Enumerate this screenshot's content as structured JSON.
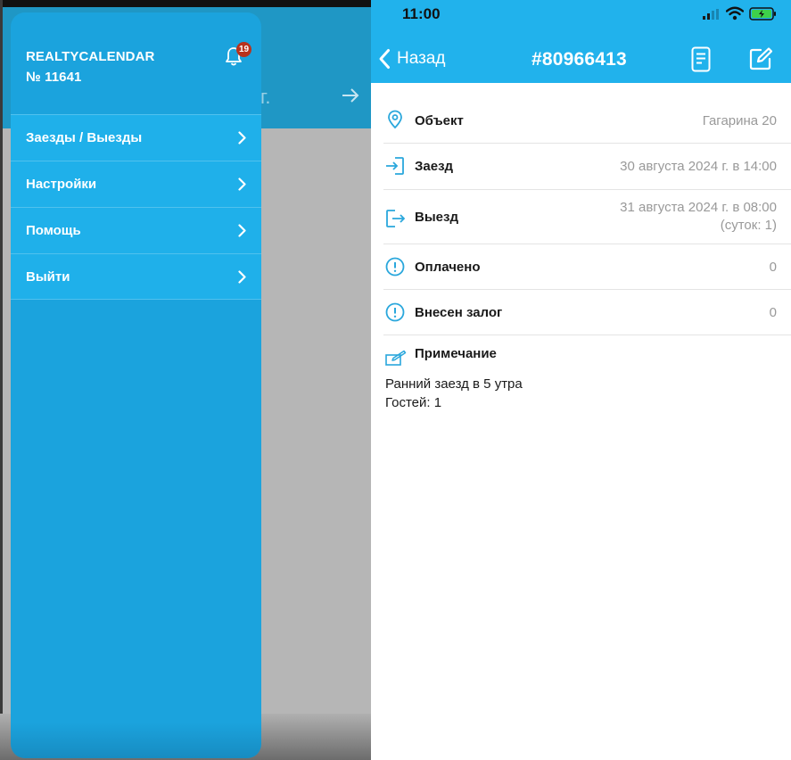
{
  "drawer": {
    "brand_line1": "REALTYCALENDAR",
    "brand_line2": "№ 11641",
    "notification_count": "19",
    "items": [
      {
        "label": "Заезды / Выезды"
      },
      {
        "label": "Настройки"
      },
      {
        "label": "Помощь"
      },
      {
        "label": "Выйти"
      }
    ]
  },
  "background_screen": {
    "date_fragment": "г."
  },
  "status_bar": {
    "time": "11:00"
  },
  "header": {
    "back_label": "Назад",
    "order_number": "#80966413"
  },
  "details": {
    "object": {
      "label": "Объект",
      "value": "Гагарина 20"
    },
    "checkin": {
      "label": "Заезд",
      "value": "30 августа 2024 г. в 14:00"
    },
    "checkout": {
      "label": "Выезд",
      "value": "31 августа 2024 г. в 08:00",
      "value_extra": "(суток: 1)"
    },
    "paid": {
      "label": "Оплачено",
      "value": "0"
    },
    "deposit": {
      "label": "Внесен залог",
      "value": "0"
    },
    "note": {
      "label": "Примечание",
      "line1": "Ранний заезд в 5 утра",
      "line2": "Гостей: 1"
    }
  },
  "colors": {
    "header_blue": "#21b2ec",
    "drawer_blue": "#1ba3dd",
    "badge_red": "#b8321d",
    "icon_blue": "#2aa7dc"
  },
  "icons": [
    "bell-icon",
    "chevron-right-icon",
    "back-chevron-icon",
    "document-icon",
    "edit-icon",
    "location-pin-icon",
    "login-icon",
    "logout-icon",
    "alert-circle-icon",
    "note-pencil-icon",
    "signal-icon",
    "wifi-icon",
    "battery-icon"
  ]
}
